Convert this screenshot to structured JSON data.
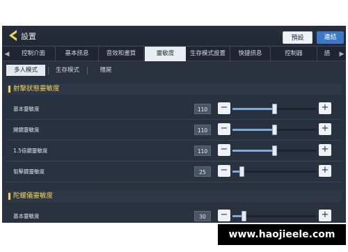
{
  "header": {
    "title": "設置",
    "default_button": "預設",
    "connect_button": "連結"
  },
  "tabs": [
    {
      "label": "控制介面"
    },
    {
      "label": "基本訊息"
    },
    {
      "label": "音效和畫質"
    },
    {
      "label": "靈敏度",
      "active": true
    },
    {
      "label": "生存模式設置"
    },
    {
      "label": "快捷訊息"
    },
    {
      "label": "控制器"
    },
    {
      "label": "語"
    }
  ],
  "subtabs": [
    {
      "label": "多人模式",
      "active": true
    },
    {
      "label": "生存模式"
    },
    {
      "label": "殭屍"
    }
  ],
  "sections": [
    {
      "title": "射擊狀態靈敏度",
      "rows": [
        {
          "label": "基本靈敏度",
          "value": "110",
          "level": 0.37
        },
        {
          "label": "開鏡靈敏度",
          "value": "110",
          "level": 0.37
        },
        {
          "label": "1.5倍鏡靈敏度",
          "value": "110",
          "level": 0.37
        },
        {
          "label": "狙擊鏡靈敏度",
          "value": "25",
          "level": 0.08
        }
      ]
    },
    {
      "title": "陀螺儀靈敏度",
      "rows": [
        {
          "label": "基本靈敏度",
          "value": "30",
          "level": 0.1
        }
      ]
    }
  ],
  "watermark": "www.haojieele.com",
  "colors": {
    "accent": "#f1d25a",
    "slider_fill": "#7fa9df",
    "connect": "#3a78c8"
  }
}
